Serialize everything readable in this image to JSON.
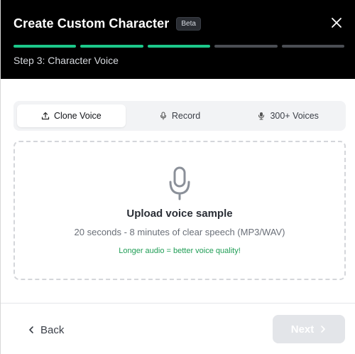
{
  "header": {
    "title": "Create Custom Character",
    "badge": "Beta",
    "step": "Step 3: Character Voice",
    "progress": {
      "total_steps": 5,
      "completed_steps": 3
    },
    "colors": {
      "background": "#000000",
      "progress_active": "#1cc88a",
      "progress_inactive": "#4a4d53"
    },
    "close_icon": "close-icon"
  },
  "tabs": [
    {
      "label": "Clone Voice",
      "icon": "upload-icon",
      "active": true
    },
    {
      "label": "Record",
      "icon": "microphone-icon",
      "active": false
    },
    {
      "label": "300+ Voices",
      "icon": "voice-library-icon",
      "active": false
    }
  ],
  "upload": {
    "icon": "microphone-icon",
    "title": "Upload voice sample",
    "subtitle": "20 seconds - 8 minutes of clear speech (MP3/WAV)",
    "hint": "Longer audio = better voice quality!",
    "hint_color": "#1f9d55"
  },
  "footer": {
    "back_label": "Back",
    "next_label": "Next",
    "next_disabled": true
  }
}
